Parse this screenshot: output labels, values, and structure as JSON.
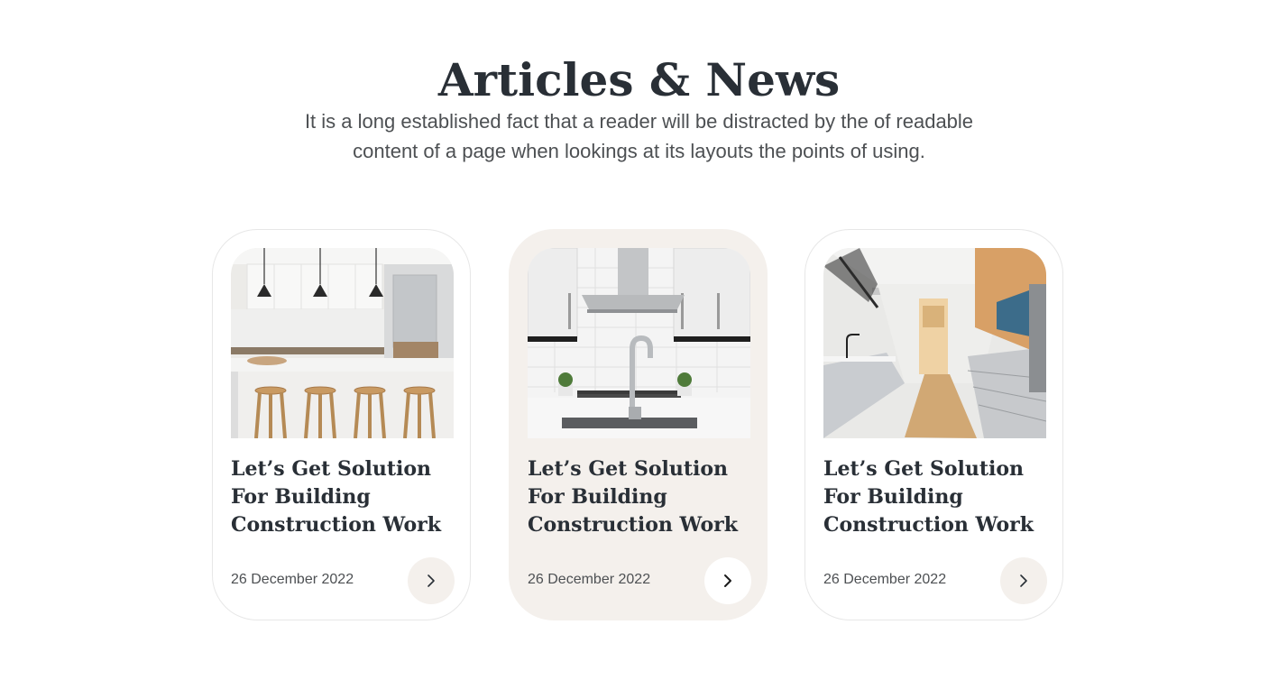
{
  "section": {
    "title": "Articles & News",
    "subtitle": "It is a long established fact that a reader will be distracted by the of readable content of a page when lookings at its layouts the points of using."
  },
  "articles": [
    {
      "title": "Let’s Get Solution For Building Construction Work",
      "date": "26 December 2022",
      "image_icon": "kitchen-island-stools-image",
      "arrow_icon": "chevron-right-icon"
    },
    {
      "title": "Let’s Get Solution For Building Construction Work",
      "date": "26 December 2022",
      "image_icon": "kitchen-sink-range-hood-image",
      "arrow_icon": "chevron-right-icon"
    },
    {
      "title": "Let’s Get Solution For Building Construction Work",
      "date": "26 December 2022",
      "image_icon": "galley-kitchen-image",
      "arrow_icon": "chevron-right-icon"
    }
  ],
  "colors": {
    "heading": "#292f36",
    "body_text": "#4d5053",
    "accent_beige": "#f4f0ec",
    "card_border": "#e7e7e7"
  }
}
